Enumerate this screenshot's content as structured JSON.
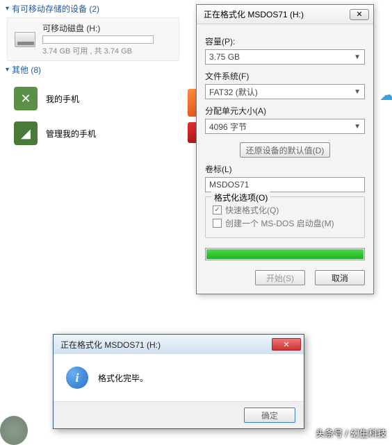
{
  "sections": {
    "removable": {
      "title": "有可移动存储的设备 (2)"
    },
    "other": {
      "title": "其他 (8)"
    }
  },
  "device": {
    "name": "可移动磁盘 (H:)",
    "sub": "3.74 GB 可用 , 共 3.74 GB"
  },
  "other_items": {
    "i0": "我的手机",
    "i1": "管理我的手机"
  },
  "format": {
    "title": "正在格式化 MSDOS71 (H:)",
    "capacity_label": "容量(P):",
    "capacity_value": "3.75 GB",
    "fs_label": "文件系统(F)",
    "fs_value": "FAT32 (默认)",
    "alloc_label": "分配单元大小(A)",
    "alloc_value": "4096 字节",
    "restore": "还原设备的默认值(D)",
    "volume_label": "卷标(L)",
    "volume_value": "MSDOS71",
    "opts_legend": "格式化选项(O)",
    "quick": "快速格式化(Q)",
    "bootdisk": "创建一个 MS-DOS 启动盘(M)",
    "start": "开始(S)",
    "cancel": "取消"
  },
  "msg": {
    "title": "正在格式化 MSDOS71 (H:)",
    "text": "格式化完毕。",
    "ok": "确定"
  },
  "watermark": "头条号 / 幻生科技"
}
